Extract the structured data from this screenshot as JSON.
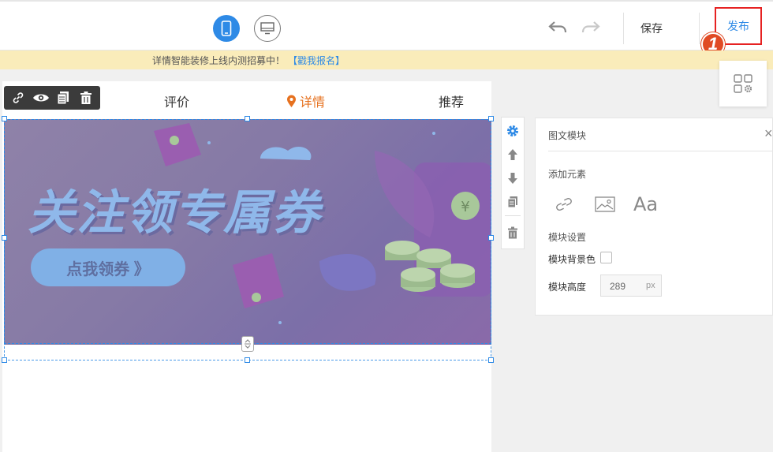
{
  "topbar": {
    "save_label": "保存",
    "publish_label": "发布",
    "step_number": "1"
  },
  "notice": {
    "text": "详情智能装修上线内测招募中！",
    "link": "【戳我报名】"
  },
  "canvas": {
    "tabs": [
      "评价",
      "详情",
      "推荐"
    ],
    "active_tab": "详情",
    "banner": {
      "title": "关注领专属券",
      "button": "点我领券 》"
    }
  },
  "panel": {
    "title": "图文模块",
    "close": "×",
    "add_elements_label": "添加元素",
    "text_element": "Aa",
    "module_settings_label": "模块设置",
    "bg_color_label": "模块背景色",
    "height_label": "模块高度",
    "height_value": "289",
    "height_unit": "px"
  },
  "colors": {
    "accent": "#2e8ae6",
    "active_tab": "#e6711f",
    "notice_bg": "#faecba",
    "publish_border": "#e62222",
    "badge": "#e04a24"
  }
}
